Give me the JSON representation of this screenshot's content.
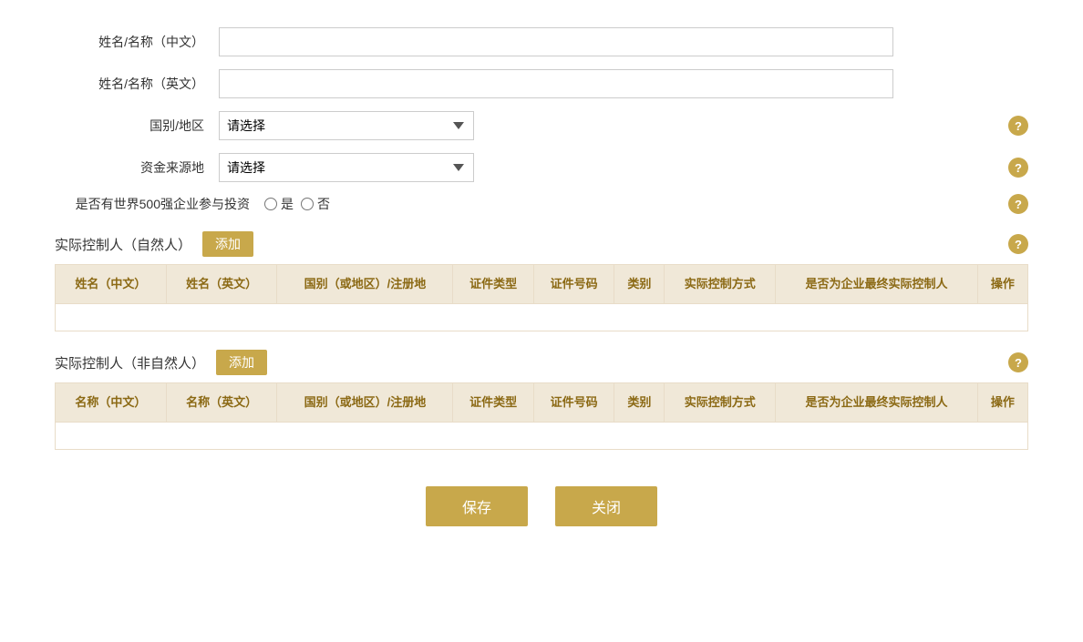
{
  "form": {
    "name_cn_label": "姓名/名称（中文）",
    "name_en_label": "姓名/名称（英文）",
    "country_label": "国别/地区",
    "country_placeholder": "请选择",
    "fund_source_label": "资金来源地",
    "fund_source_placeholder": "请选择",
    "fortune500_label": "是否有世界500强企业参与投资",
    "fortune500_yes": "是",
    "fortune500_no": "否",
    "name_cn_value": "",
    "name_en_value": ""
  },
  "controller_natural": {
    "section_title": "实际控制人（自然人）",
    "add_btn_label": "添加",
    "columns": [
      "姓名（中文）",
      "姓名（英文）",
      "国别（或地区）/注册地",
      "证件类型",
      "证件号码",
      "类别",
      "实际控制方式",
      "是否为企业最终实际控制人",
      "操作"
    ]
  },
  "controller_non_natural": {
    "section_title": "实际控制人（非自然人）",
    "add_btn_label": "添加",
    "columns": [
      "名称（中文）",
      "名称（英文）",
      "国别（或地区）/注册地",
      "证件类型",
      "证件号码",
      "类别",
      "实际控制方式",
      "是否为企业最终实际控制人",
      "操作"
    ]
  },
  "footer": {
    "save_label": "保存",
    "close_label": "关闭"
  },
  "icons": {
    "help": "?",
    "chevron_down": "▼"
  }
}
